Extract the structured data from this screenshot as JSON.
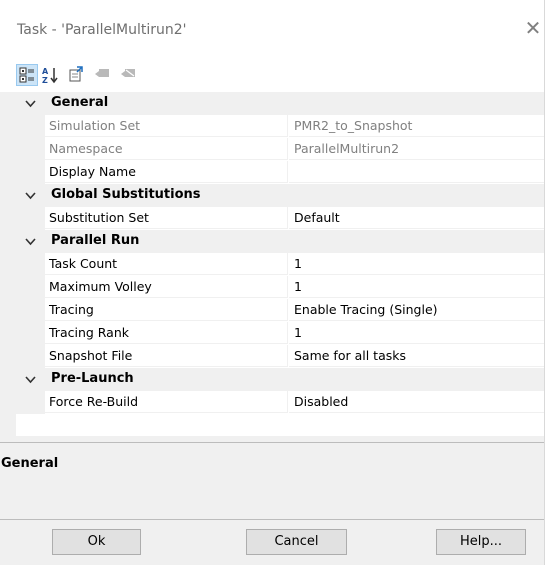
{
  "window": {
    "title": "Task - 'ParallelMultirun2'"
  },
  "toolbar": {
    "icons": [
      "categorized-icon",
      "sort-alpha-icon",
      "property-pages-icon",
      "comment-icon",
      "uncomment-icon"
    ]
  },
  "categories": [
    {
      "label": "General",
      "props": [
        {
          "name": "Simulation Set",
          "value": "PMR2_to_Snapshot",
          "readonly": true
        },
        {
          "name": "Namespace",
          "value": "ParallelMultirun2",
          "readonly": true
        },
        {
          "name": "Display Name",
          "value": "",
          "readonly": false
        }
      ]
    },
    {
      "label": "Global Substitutions",
      "props": [
        {
          "name": "Substitution Set",
          "value": "Default",
          "readonly": false
        }
      ]
    },
    {
      "label": "Parallel Run",
      "props": [
        {
          "name": "Task Count",
          "value": "1",
          "readonly": false
        },
        {
          "name": "Maximum Volley",
          "value": "1",
          "readonly": false
        },
        {
          "name": "Tracing",
          "value": "Enable Tracing (Single)",
          "readonly": false
        },
        {
          "name": "Tracing Rank",
          "value": "1",
          "readonly": false
        },
        {
          "name": "Snapshot File",
          "value": "Same for all tasks",
          "readonly": false
        }
      ]
    },
    {
      "label": "Pre-Launch",
      "props": [
        {
          "name": "Force Re-Build",
          "value": "Disabled",
          "readonly": false
        }
      ]
    }
  ],
  "description": {
    "title": "General"
  },
  "buttons": {
    "ok": "Ok",
    "cancel": "Cancel",
    "help": "Help..."
  }
}
